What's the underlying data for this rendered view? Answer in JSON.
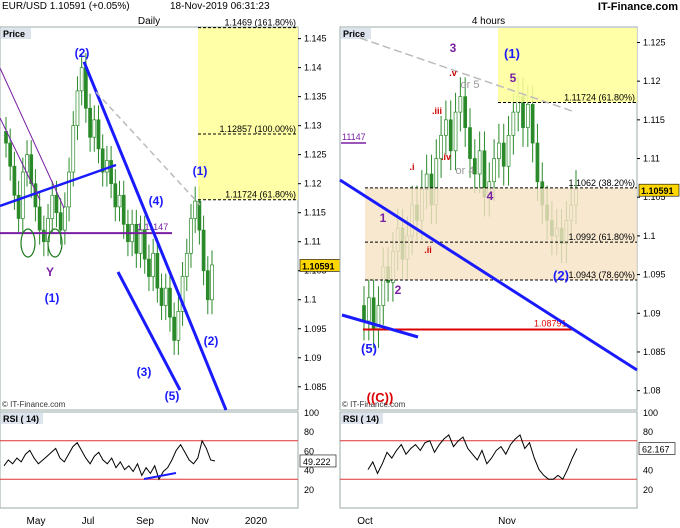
{
  "header": {
    "symbol_line": "EUR/USD   1.10591 (+0.05%)",
    "datetime": "18-Nov-2019 06:31:23",
    "brand": "IT-Finance.com"
  },
  "colors": {
    "wave_blue": "#1a1aff",
    "wave_purple": "#7a1fa2",
    "sub_red": "#cc0000",
    "fib_zone": "#ffff99",
    "wave_zone": "#f6e2c4",
    "price_tag": "#ffd700"
  },
  "chart_data": [
    {
      "type": "candlestick",
      "title": "Daily",
      "panel_label": "Price",
      "watermark": "© IT-Finance.com",
      "y_ticks": [
        "1.145",
        "1.14",
        "1.135",
        "1.13",
        "1.125",
        "1.12",
        "1.115",
        "1.11",
        "1.105",
        "1.1",
        "1.095",
        "1.09",
        "1.085"
      ],
      "ylim": [
        1.081,
        1.147
      ],
      "x_ticks": [
        "May",
        "Jul",
        "Sep",
        "Nov",
        "2020"
      ],
      "fib_levels": [
        {
          "price": 1.1469,
          "label": "1.1469 (161.80%)"
        },
        {
          "price": 1.12857,
          "label": "1.12857 (100.00%)"
        },
        {
          "price": 1.11724,
          "label": "1.11724 (61.80%)"
        }
      ],
      "horizontal_line": {
        "price": 1.11147,
        "label": "1.11147"
      },
      "last_price": "1.10591",
      "wave_labels": [
        "(2)",
        "(4)",
        "(1)",
        "(1)",
        "(2)",
        "(3)",
        "(5)",
        "Y"
      ],
      "closes": [
        1.127,
        1.123,
        1.118,
        1.114,
        1.122,
        1.125,
        1.12,
        1.116,
        1.112,
        1.11,
        1.114,
        1.118,
        1.115,
        1.112,
        1.116,
        1.122,
        1.13,
        1.136,
        1.14,
        1.133,
        1.128,
        1.131,
        1.126,
        1.122,
        1.124,
        1.12,
        1.116,
        1.118,
        1.113,
        1.11,
        1.113,
        1.108,
        1.112,
        1.107,
        1.104,
        1.108,
        1.102,
        1.099,
        1.102,
        1.097,
        1.093,
        1.098,
        1.104,
        1.108,
        1.114,
        1.117,
        1.112,
        1.105,
        1.1,
        1.106
      ],
      "rsi": {
        "label": "RSI ( 14)",
        "value": "49.222",
        "y_ticks": [
          "100",
          "80",
          "60",
          "40",
          "20"
        ],
        "levels": [
          70,
          30
        ],
        "values": [
          44,
          50,
          46,
          52,
          48,
          56,
          60,
          52,
          46,
          50,
          54,
          58,
          62,
          52,
          48,
          56,
          64,
          68,
          60,
          52,
          46,
          54,
          58,
          50,
          46,
          52,
          42,
          48,
          40,
          44,
          38,
          46,
          34,
          42,
          36,
          44,
          30,
          38,
          42,
          50,
          60,
          66,
          58,
          50,
          46,
          52,
          70,
          62,
          50,
          49
        ]
      }
    },
    {
      "type": "candlestick",
      "title": "4 hours",
      "panel_label": "Price",
      "watermark": "© IT-Finance.com",
      "y_ticks": [
        "1.125",
        "1.12",
        "1.115",
        "1.11",
        "1.105",
        "1.1",
        "1.095",
        "1.09",
        "1.085",
        "1.08"
      ],
      "ylim": [
        1.0775,
        1.127
      ],
      "x_ticks": [
        "Oct",
        "Nov"
      ],
      "left_marker": "11147",
      "fib_levels": [
        {
          "price": 1.11724,
          "label": "1.11724 (61.80%)"
        },
        {
          "price": 1.1062,
          "label": "1.1062 (38.20%)"
        },
        {
          "price": 1.0992,
          "label": "1.0992 (61.80%)"
        },
        {
          "price": 1.0943,
          "label": "1.0943 (78.60%)"
        }
      ],
      "horizontal_line": {
        "price": 1.08791,
        "label": "1.08791"
      },
      "last_price": "1.10591",
      "wave_labels_blue": [
        "(1)",
        "(2)",
        "(5)",
        "((C))"
      ],
      "wave_labels_purple": [
        "3",
        "5",
        "1",
        "2",
        "4"
      ],
      "wave_labels_grey": [
        "or 5",
        "or 4"
      ],
      "wave_labels_red": [
        ".v",
        ".iii",
        ".i",
        ".iv",
        ".ii"
      ],
      "closes": [
        1.089,
        1.092,
        1.088,
        1.091,
        1.096,
        1.094,
        1.098,
        1.101,
        1.097,
        1.1,
        1.104,
        1.102,
        1.106,
        1.108,
        1.104,
        1.11,
        1.113,
        1.115,
        1.111,
        1.116,
        1.118,
        1.114,
        1.11,
        1.108,
        1.111,
        1.105,
        1.107,
        1.11,
        1.112,
        1.109,
        1.113,
        1.116,
        1.118,
        1.114,
        1.117,
        1.112,
        1.107,
        1.104,
        1.102,
        1.1,
        1.101,
        1.099,
        1.102,
        1.104,
        1.106
      ],
      "rsi": {
        "label": "RSI ( 14)",
        "value": "62.167",
        "y_ticks": [
          "100",
          "80",
          "60",
          "40",
          "20"
        ],
        "levels": [
          70,
          30
        ],
        "values": [
          40,
          48,
          36,
          46,
          58,
          52,
          60,
          66,
          56,
          62,
          66,
          60,
          68,
          70,
          58,
          66,
          72,
          76,
          64,
          70,
          74,
          62,
          56,
          50,
          60,
          46,
          52,
          60,
          64,
          56,
          66,
          72,
          76,
          62,
          68,
          52,
          40,
          34,
          30,
          30,
          34,
          30,
          40,
          52,
          62
        ]
      }
    }
  ]
}
